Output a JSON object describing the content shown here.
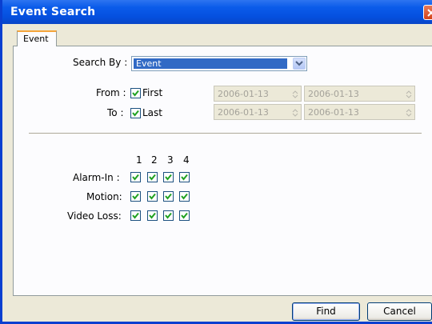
{
  "window": {
    "title": "Event Search"
  },
  "tabs": [
    {
      "label": "Event"
    }
  ],
  "search_by": {
    "label": "Search By :",
    "value": "Event"
  },
  "from": {
    "label": "From :",
    "checkbox_label": "First",
    "checked": true,
    "date_1": "2006-01-13",
    "date_2": "2006-01-13"
  },
  "to": {
    "label": "To :",
    "checkbox_label": "Last",
    "checked": true,
    "date_1": "2006-01-13",
    "date_2": "2006-01-13"
  },
  "channels": [
    "1",
    "2",
    "3",
    "4"
  ],
  "rows": [
    {
      "label": "Alarm-In :",
      "checked": [
        true,
        true,
        true,
        true
      ]
    },
    {
      "label": "Motion:",
      "checked": [
        true,
        true,
        true,
        true
      ]
    },
    {
      "label": "Video Loss:",
      "checked": [
        true,
        true,
        true,
        true
      ]
    }
  ],
  "buttons": {
    "find": "Find",
    "cancel": "Cancel"
  },
  "colors": {
    "titlebar": "#0550df",
    "selection": "#316ac5",
    "checkmark": "#21a121",
    "close": "#d4431a"
  }
}
